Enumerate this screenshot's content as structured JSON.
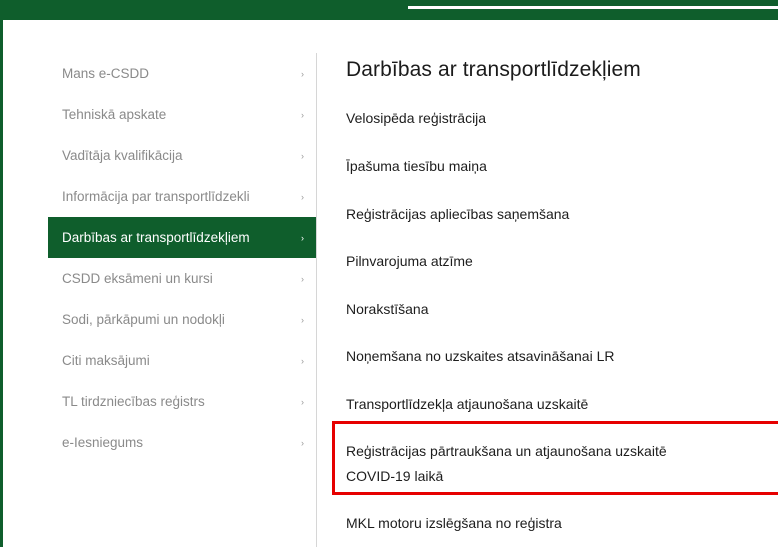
{
  "sidebar": {
    "items": [
      {
        "label": "Mans e-CSDD",
        "chevron": "›"
      },
      {
        "label": "Tehniskā apskate",
        "chevron": "›"
      },
      {
        "label": "Vadītāja kvalifikācija",
        "chevron": "›"
      },
      {
        "label": "Informācija par transportlīdzekli",
        "chevron": "›"
      },
      {
        "label": "Darbības ar transportlīdzekļiem",
        "chevron": "›",
        "active": true
      },
      {
        "label": "CSDD eksāmeni un kursi",
        "chevron": "›"
      },
      {
        "label": "Sodi, pārkāpumi un nodokļi",
        "chevron": "›"
      },
      {
        "label": "Citi maksājumi",
        "chevron": "›"
      },
      {
        "label": "TL tirdzniecības reģistrs",
        "chevron": "›"
      },
      {
        "label": "e-Iesniegums",
        "chevron": "›"
      }
    ]
  },
  "main": {
    "title": "Darbības ar transportlīdzekļiem",
    "links": [
      {
        "label": "Velosipēda reģistrācija"
      },
      {
        "label": "Īpašuma tiesību maiņa"
      },
      {
        "label": "Reģistrācijas apliecības saņemšana"
      },
      {
        "label": "Pilnvarojuma atzīme"
      },
      {
        "label": "Norakstīšana"
      },
      {
        "label": "Noņemšana no uzskaites atsavināšanai LR"
      },
      {
        "label": "Transportlīdzekļa atjaunošana uzskaitē"
      },
      {
        "label_line1": "Reģistrācijas pārtraukšana un atjaunošana uzskaitē",
        "label_line2": "COVID-19 laikā"
      },
      {
        "label": "MKL motoru izslēgšana no reģistra"
      }
    ]
  },
  "colors": {
    "brand_green": "#0f5e2c",
    "highlight_red": "#e60000"
  }
}
